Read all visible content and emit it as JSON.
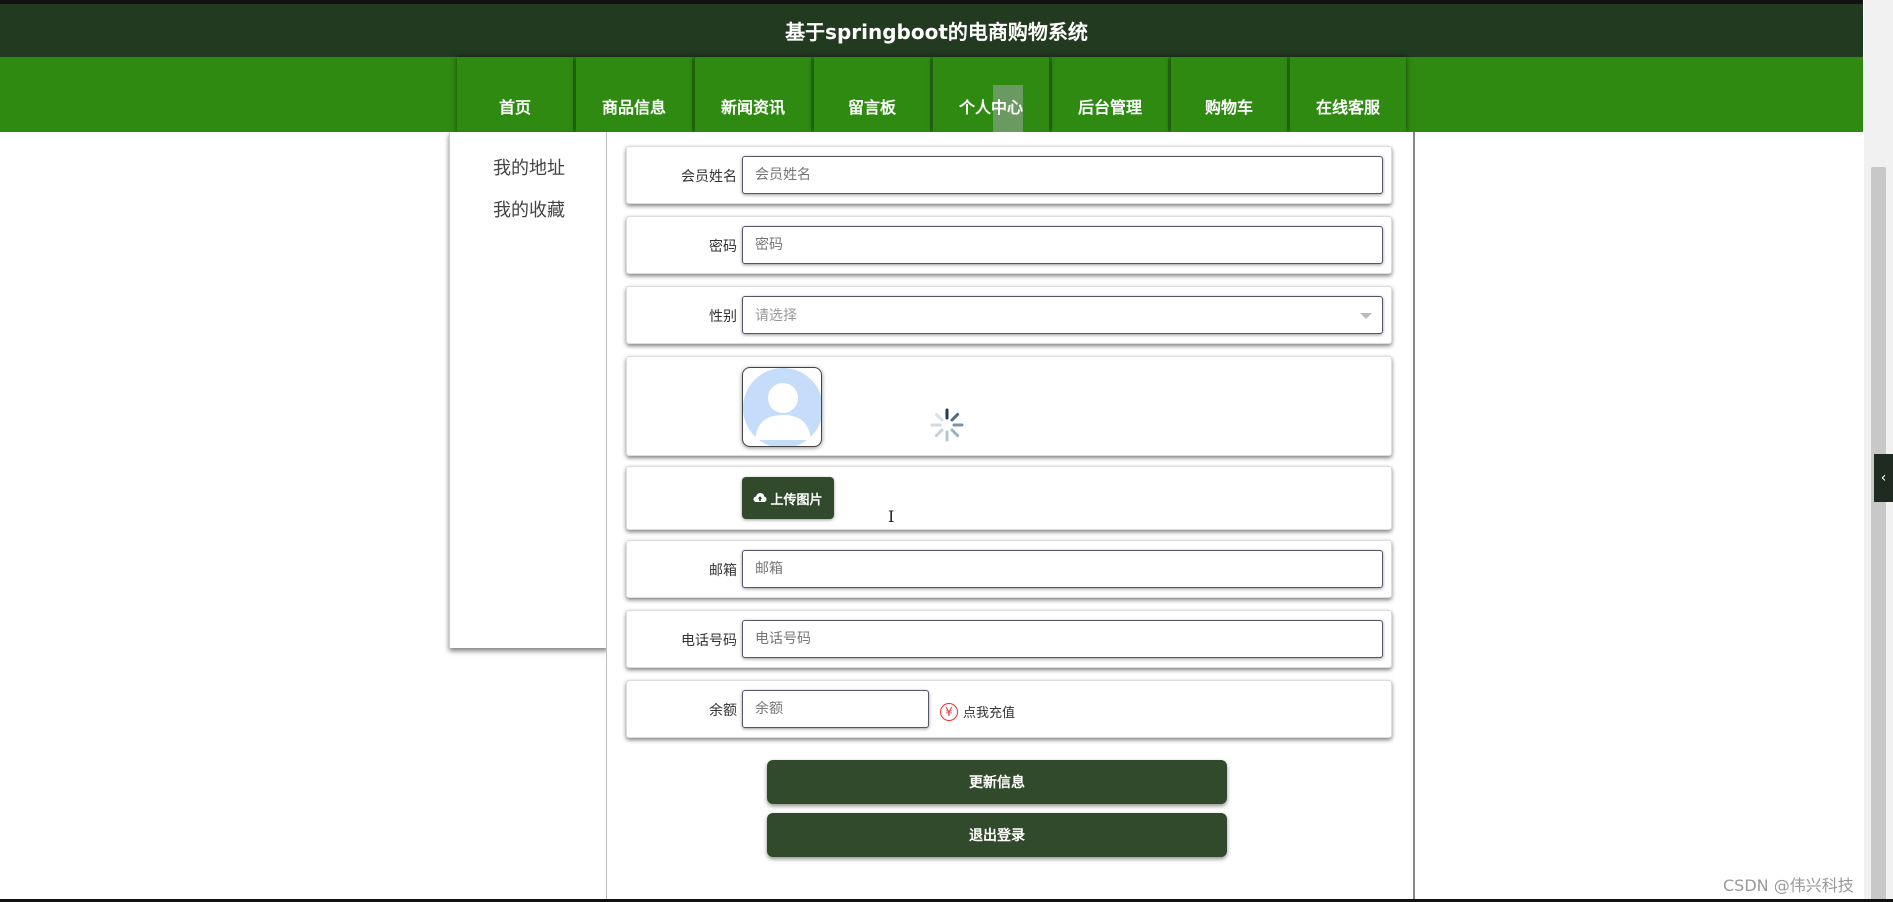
{
  "header": {
    "title": "基于springboot的电商购物系统"
  },
  "nav": {
    "items": [
      {
        "label": "首页"
      },
      {
        "label": "商品信息"
      },
      {
        "label": "新闻资讯"
      },
      {
        "label": "留言板"
      },
      {
        "label": "个人中心"
      },
      {
        "label": "后台管理"
      },
      {
        "label": "购物车"
      },
      {
        "label": "在线客服"
      }
    ],
    "active": "个人中心"
  },
  "sidebar": {
    "items": [
      {
        "label": "我的地址"
      },
      {
        "label": "我的收藏"
      }
    ]
  },
  "form": {
    "member_name": {
      "label": "会员姓名",
      "placeholder": "会员姓名",
      "value": ""
    },
    "password": {
      "label": "密码",
      "placeholder": "密码",
      "value": ""
    },
    "gender": {
      "label": "性别",
      "placeholder": "请选择"
    },
    "upload_label": "上传图片",
    "email": {
      "label": "邮箱",
      "placeholder": "邮箱",
      "value": ""
    },
    "phone": {
      "label": "电话号码",
      "placeholder": "电话号码",
      "value": ""
    },
    "balance": {
      "label": "余额",
      "placeholder": "余额",
      "value": "",
      "recharge_symbol": "¥",
      "recharge_label": "点我充值"
    }
  },
  "actions": {
    "update_label": "更新信息",
    "logout_label": "退出登录"
  },
  "watermark": "CSDN @伟兴科技",
  "colors": {
    "header_bg": "#223a1f",
    "nav_bg": "#2f8a12",
    "button_bg": "#324a2c"
  }
}
